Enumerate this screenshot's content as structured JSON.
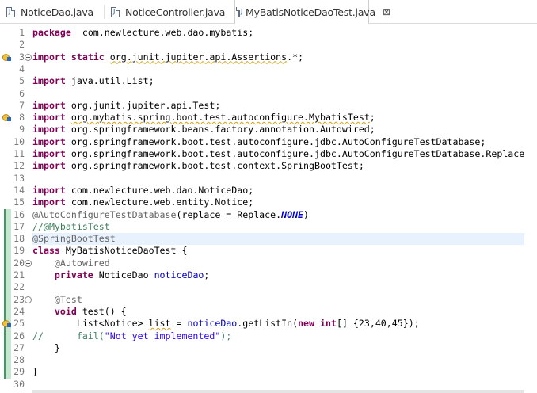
{
  "tabs": [
    {
      "label": "NoticeDao.java",
      "active": false
    },
    {
      "label": "NoticeController.java",
      "active": false
    },
    {
      "label": "MyBatisNoticeDaoTest.java",
      "active": true
    }
  ],
  "tab_close_glyph": "⊠",
  "highlighted_line": 18,
  "lines": [
    {
      "n": "1",
      "seg": [
        [
          "kw",
          "package"
        ],
        [
          "",
          "  com.newlecture.web.dao.mybatis;"
        ]
      ]
    },
    {
      "n": "2",
      "seg": []
    },
    {
      "n": "3",
      "fold": true,
      "warn": true,
      "seg": [
        [
          "kw",
          "import"
        ],
        [
          "",
          " "
        ],
        [
          "kw",
          "static"
        ],
        [
          "",
          " "
        ],
        [
          "wv",
          "org.junit.jupiter.api.Assertions"
        ],
        [
          "",
          ".*;"
        ]
      ]
    },
    {
      "n": "4",
      "seg": []
    },
    {
      "n": "5",
      "seg": [
        [
          "kw",
          "import"
        ],
        [
          "",
          " java.util.List;"
        ]
      ]
    },
    {
      "n": "6",
      "seg": []
    },
    {
      "n": "7",
      "seg": [
        [
          "kw",
          "import"
        ],
        [
          "",
          " org.junit.jupiter.api.Test;"
        ]
      ]
    },
    {
      "n": "8",
      "warn": true,
      "seg": [
        [
          "kw",
          "import"
        ],
        [
          "",
          " "
        ],
        [
          "wv",
          "org.mybatis.spring.boot.test.autoconfigure.MybatisTest"
        ],
        [
          "",
          ";"
        ]
      ]
    },
    {
      "n": "9",
      "seg": [
        [
          "kw",
          "import"
        ],
        [
          "",
          " org.springframework.beans.factory.annotation.Autowired;"
        ]
      ]
    },
    {
      "n": "10",
      "seg": [
        [
          "kw",
          "import"
        ],
        [
          "",
          " org.springframework.boot.test.autoconfigure.jdbc.AutoConfigureTestDatabase;"
        ]
      ]
    },
    {
      "n": "11",
      "seg": [
        [
          "kw",
          "import"
        ],
        [
          "",
          " org.springframework.boot.test.autoconfigure.jdbc.AutoConfigureTestDatabase.Replace"
        ]
      ]
    },
    {
      "n": "12",
      "seg": [
        [
          "kw",
          "import"
        ],
        [
          "",
          " org.springframework.boot.test.context.SpringBootTest;"
        ]
      ]
    },
    {
      "n": "13",
      "seg": []
    },
    {
      "n": "14",
      "seg": [
        [
          "kw",
          "import"
        ],
        [
          "",
          " com.newlecture.web.dao.NoticeDao;"
        ]
      ]
    },
    {
      "n": "15",
      "seg": [
        [
          "kw",
          "import"
        ],
        [
          "",
          " com.newlecture.web.entity.Notice;"
        ]
      ]
    },
    {
      "n": "16",
      "qd": true,
      "seg": [
        [
          "an",
          "@AutoConfigureTestDatabase"
        ],
        [
          "",
          "(replace = Replace."
        ],
        [
          "ncst",
          "NONE"
        ],
        [
          "",
          ")"
        ]
      ]
    },
    {
      "n": "17",
      "qd": true,
      "seg": [
        [
          "cm",
          "//@MybatisTest"
        ]
      ]
    },
    {
      "n": "18",
      "qd": true,
      "seg": [
        [
          "an",
          "@SpringBootTest"
        ]
      ]
    },
    {
      "n": "19",
      "qd": true,
      "seg": [
        [
          "kw",
          "class"
        ],
        [
          "",
          " MyBatisNoticeDaoTest {"
        ]
      ]
    },
    {
      "n": "20",
      "qd": true,
      "fold": true,
      "seg": [
        [
          "",
          "    "
        ],
        [
          "an",
          "@Autowired"
        ]
      ]
    },
    {
      "n": "21",
      "qd": true,
      "seg": [
        [
          "",
          "    "
        ],
        [
          "kw",
          "private"
        ],
        [
          "",
          " NoticeDao "
        ],
        [
          "fd",
          "noticeDao"
        ],
        [
          "",
          ";"
        ]
      ]
    },
    {
      "n": "22",
      "qd": true,
      "seg": []
    },
    {
      "n": "23",
      "qd": true,
      "fold": true,
      "seg": [
        [
          "",
          "    "
        ],
        [
          "an",
          "@Test"
        ]
      ]
    },
    {
      "n": "24",
      "qd": true,
      "seg": [
        [
          "",
          "    "
        ],
        [
          "kw",
          "void"
        ],
        [
          "",
          " test() {"
        ]
      ]
    },
    {
      "n": "25",
      "qd": true,
      "warn": true,
      "seg": [
        [
          "",
          "        List<Notice> "
        ],
        [
          "wv",
          "list"
        ],
        [
          "",
          " = "
        ],
        [
          "fd",
          "noticeDao"
        ],
        [
          "",
          ".getListIn("
        ],
        [
          "kw",
          "new"
        ],
        [
          "",
          " "
        ],
        [
          "kw",
          "int"
        ],
        [
          "",
          "[] {23,40,45});"
        ]
      ]
    },
    {
      "n": "26",
      "qd": true,
      "seg": [
        [
          "cm",
          "//      fail("
        ],
        [
          "st",
          "\"Not yet implemented\""
        ],
        [
          "cm",
          ");"
        ]
      ]
    },
    {
      "n": "27",
      "qd": true,
      "seg": [
        [
          "",
          "    }"
        ]
      ]
    },
    {
      "n": "28",
      "qd": true,
      "seg": []
    },
    {
      "n": "29",
      "qd": true,
      "seg": [
        [
          "",
          "}"
        ]
      ]
    },
    {
      "n": "30",
      "seg": []
    }
  ]
}
